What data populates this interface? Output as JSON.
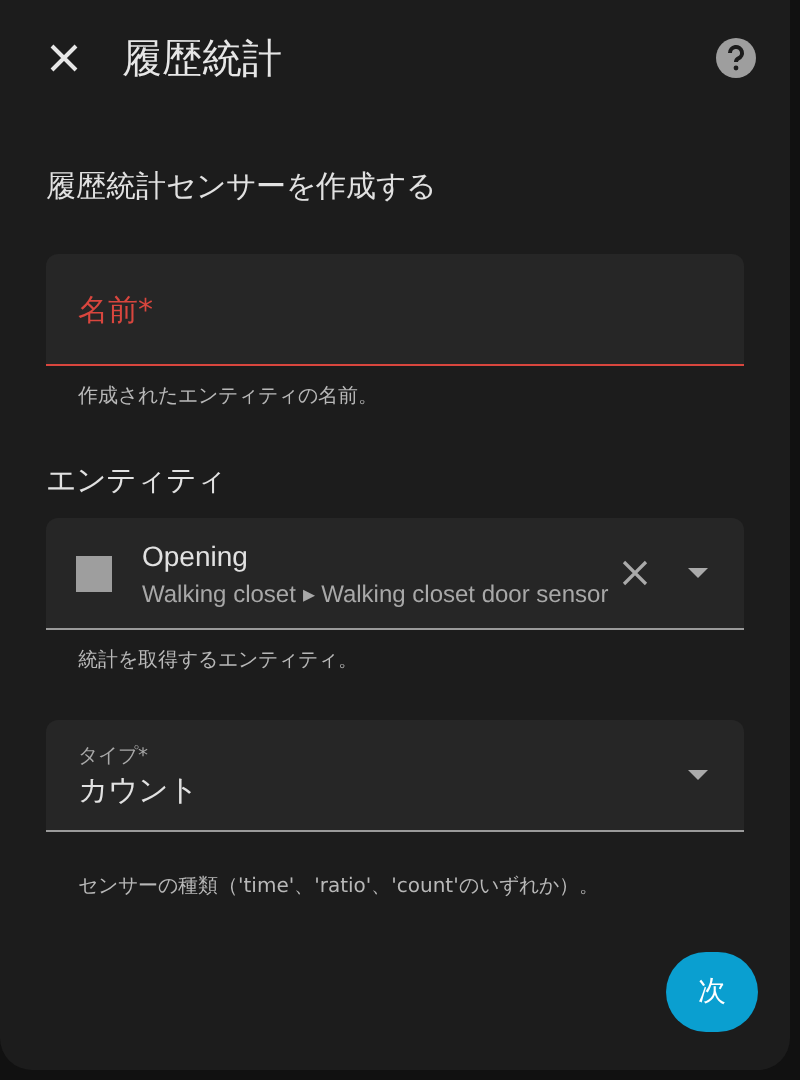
{
  "dialog": {
    "title": "履歴統計"
  },
  "heading": "履歴統計センサーを作成する",
  "name_field": {
    "label": "名前*",
    "invalid": true,
    "helper": "作成されたエンティティの名前。"
  },
  "entity_section": {
    "label": "エンティティ"
  },
  "entity_field": {
    "name": "Opening",
    "path": "Walking closet ▸ Walking closet door sensor",
    "helper": "統計を取得するエンティティ。"
  },
  "type_field": {
    "label": "タイプ*",
    "value": "カウント",
    "helper": "センサーの種類（'time'、'ratio'、'count'のいずれか）。"
  },
  "next_button": {
    "label": "次"
  }
}
